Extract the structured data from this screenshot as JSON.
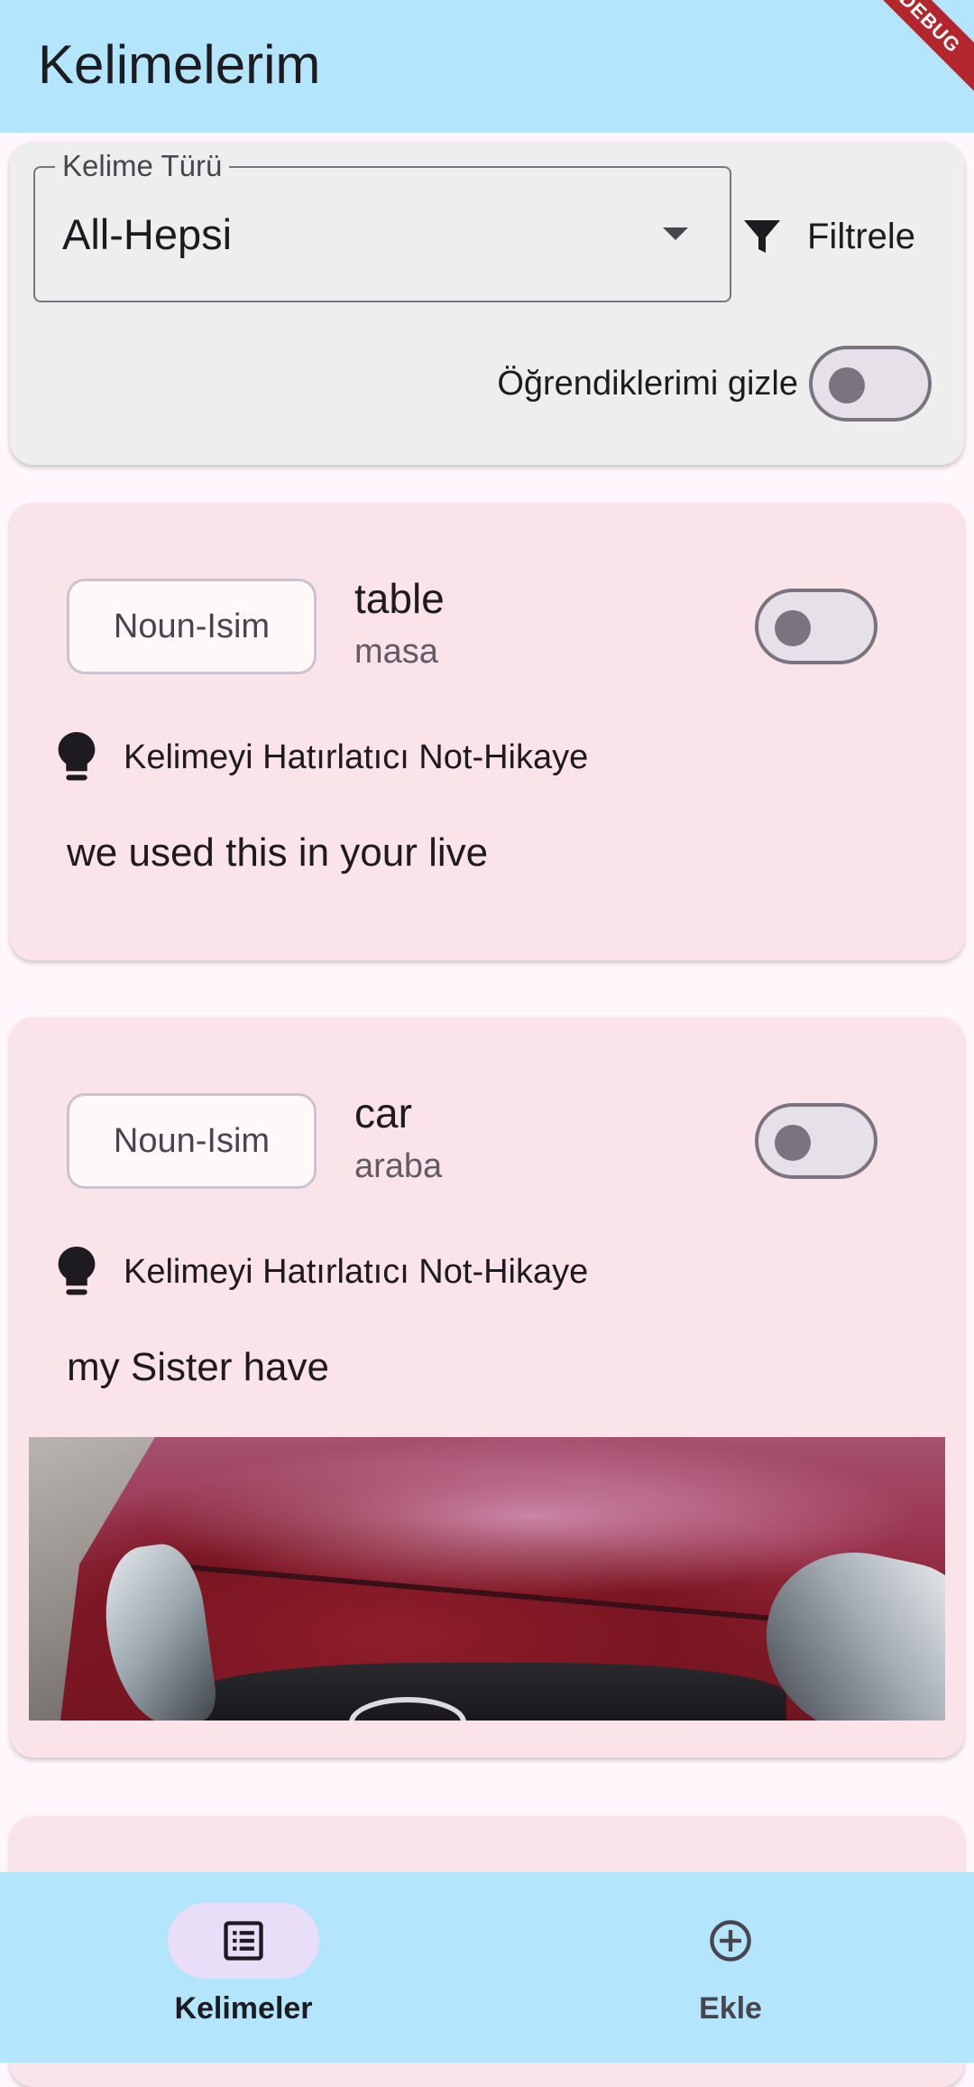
{
  "app_bar": {
    "title": "Kelimelerim",
    "debug_banner": "DEBUG"
  },
  "filter": {
    "select_label": "Kelime Türü",
    "select_value": "All-Hepsi",
    "filter_button_label": "Filtrele",
    "hide_learned_label": "Öğrendiklerimi gizle",
    "hide_learned_on": false
  },
  "words": [
    {
      "type": "Noun-Isim",
      "word": "table",
      "meaning": "masa",
      "learned": false,
      "note_label": "Kelimeyi Hatırlatıcı Not-Hikaye",
      "story": "we used this in your live",
      "has_image": false
    },
    {
      "type": "Noun-Isim",
      "word": "car",
      "meaning": "araba",
      "learned": false,
      "note_label": "Kelimeyi Hatırlatıcı Not-Hikaye",
      "story": "my Sister have",
      "has_image": true
    }
  ],
  "bottom_nav": {
    "items": [
      {
        "label": "Kelimeler",
        "icon": "list-alt-icon",
        "active": true
      },
      {
        "label": "Ekle",
        "icon": "add-circle-outline-icon",
        "active": false
      }
    ]
  },
  "colors": {
    "app_bar": "#b3e5fc",
    "card_background": "#fae4ea",
    "filter_card": "#eeeeee",
    "page_background": "#fff7fc",
    "active_nav_pill": "#e8def8"
  }
}
